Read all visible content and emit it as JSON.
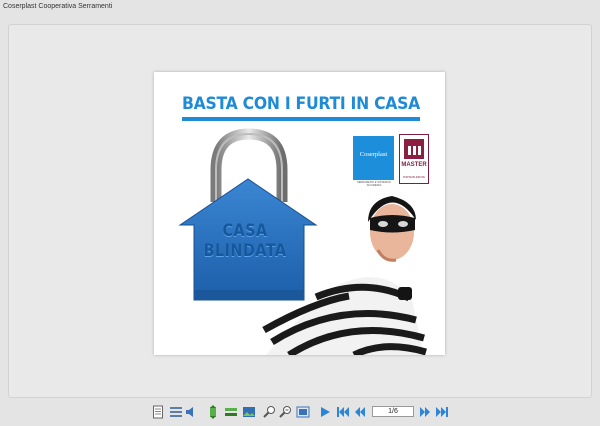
{
  "window": {
    "title": "Coserplast Cooperativa Serramenti"
  },
  "page": {
    "headline": "BASTA CON I FURTI IN CASA",
    "lock_text_line1": "CASA",
    "lock_text_line2": "BLINDATA",
    "logo_coserplast": {
      "name": "Coserplast",
      "tagline": "SERRAMENTI E SISTEMI DI SICUREZZA"
    },
    "logo_master": {
      "name": "MASTER",
      "subtitle": "PORTE BLINDATE"
    }
  },
  "toolbar": {
    "page_indicator": "1/6",
    "buttons": [
      "document-icon",
      "thumbnails-icon",
      "sound-icon",
      "fit-height-icon",
      "fit-width-icon",
      "image-icon",
      "zoom-out-icon",
      "zoom-in-icon",
      "fullscreen-icon",
      "play-icon",
      "first-page-icon",
      "previous-page-icon",
      "next-page-icon",
      "last-page-icon"
    ]
  },
  "colors": {
    "brand_blue": "#1f8bd6",
    "master_red": "#8a1f41",
    "background": "#e4e4e4"
  }
}
